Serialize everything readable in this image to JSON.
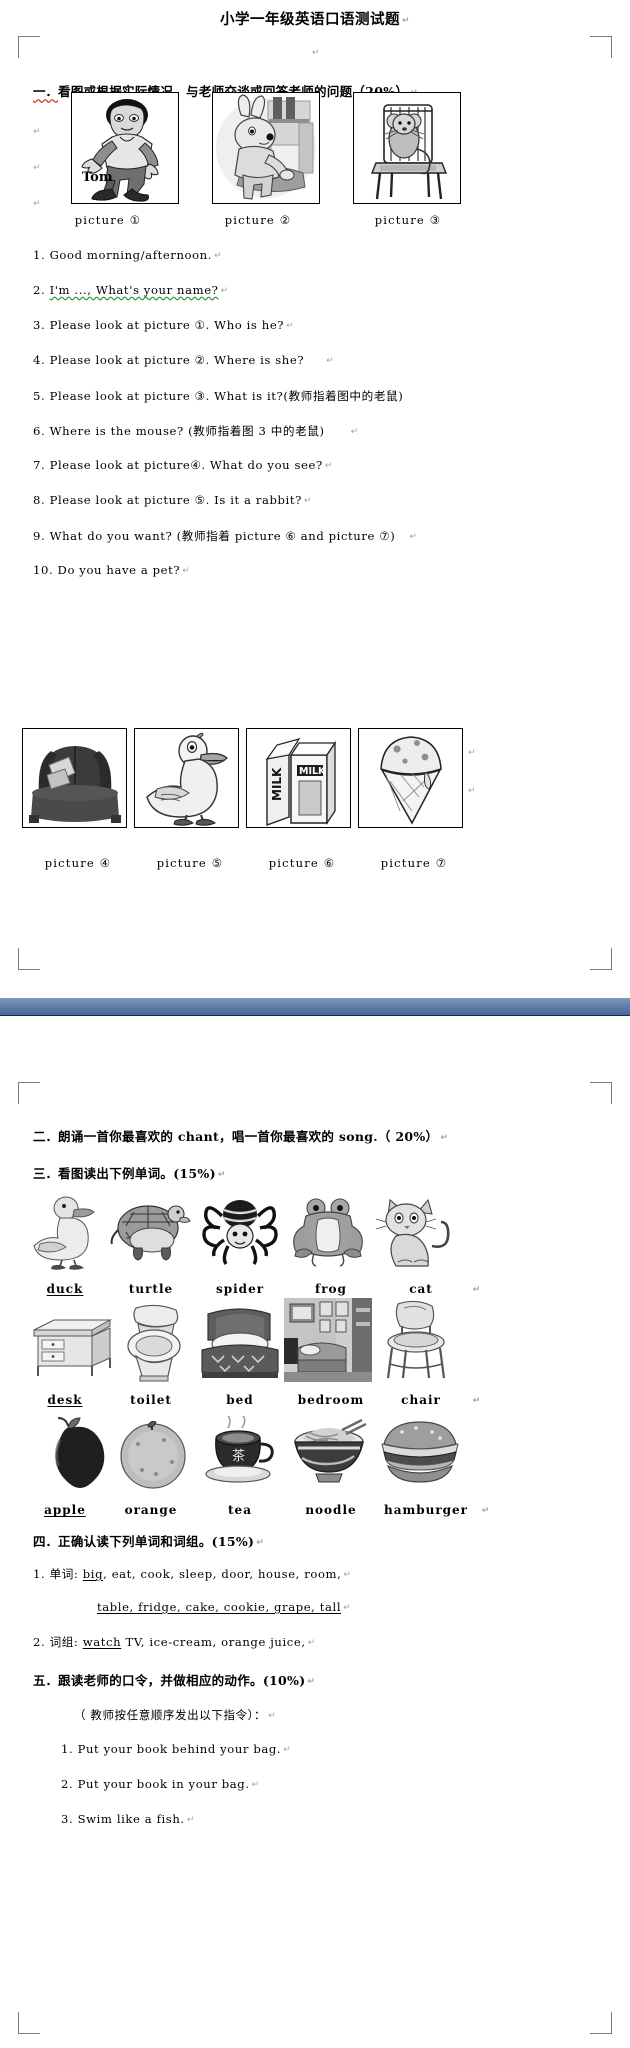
{
  "document": {
    "title": "小学一年级英语口语测试题",
    "pilcrow": "↵"
  },
  "section1": {
    "heading_num": "一．",
    "heading_text": "看图或根据实际情况，与老师交谈或回答老师的问题（20%）",
    "pictures_top": [
      {
        "caption": "picture",
        "num": "①",
        "icon": "boy-walking-icon",
        "label": "Tom"
      },
      {
        "caption": "picture",
        "num": "②",
        "icon": "rabbit-at-desk-icon",
        "label": ""
      },
      {
        "caption": "picture",
        "num": "③",
        "icon": "mouse-on-chair-icon",
        "label": ""
      }
    ],
    "questions": [
      {
        "n": "1.",
        "text": "Good morning/afternoon."
      },
      {
        "n": "2.",
        "text": "I'm ..., What's your name?"
      },
      {
        "n": "3.",
        "text": "Please look at picture ①. Who is he?"
      },
      {
        "n": "4.",
        "text": "Please look at picture ②. Where is she?"
      },
      {
        "n": "5.",
        "text": "Please look at picture ③.  What is it?(教师指着图中的老鼠)"
      },
      {
        "n": "6.",
        "text": "Where is the mouse? (教师指着图 3 中的老鼠)"
      },
      {
        "n": "7.",
        "text": "Please look at picture④.  What do you see?"
      },
      {
        "n": "8.",
        "text": "Please look at picture ⑤. Is it a rabbit?"
      },
      {
        "n": "9.",
        "text": "What do you want? (教师指着 picture ⑥  and picture ⑦)"
      },
      {
        "n": "10.",
        "text": "Do you have a pet?"
      }
    ],
    "pictures_bottom": [
      {
        "caption": "picture",
        "num": "④",
        "icon": "armchair-icon"
      },
      {
        "caption": "picture",
        "num": "⑤",
        "icon": "duck-icon"
      },
      {
        "caption": "picture",
        "num": "⑥",
        "icon": "milk-carton-icon"
      },
      {
        "caption": "picture",
        "num": "⑦",
        "icon": "ice-cream-cone-icon"
      }
    ]
  },
  "section2": {
    "heading_num": "二．",
    "heading_text": "朗诵一首你最喜欢的 chant，唱一首你最喜欢的 song.（ 20%）"
  },
  "section3": {
    "heading_num": "三．",
    "heading_text": "看图读出下例单词。(15%)",
    "rows": [
      [
        {
          "word": "duck",
          "icon": "duck-icon",
          "misspelled": true
        },
        {
          "word": "turtle",
          "icon": "turtle-icon",
          "misspelled": false
        },
        {
          "word": "spider",
          "icon": "spider-icon",
          "misspelled": false
        },
        {
          "word": "frog",
          "icon": "frog-icon",
          "misspelled": false
        },
        {
          "word": "cat",
          "icon": "cat-icon",
          "misspelled": false
        }
      ],
      [
        {
          "word": "desk",
          "icon": "desk-icon",
          "misspelled": true
        },
        {
          "word": "toilet",
          "icon": "toilet-icon",
          "misspelled": false
        },
        {
          "word": "bed",
          "icon": "bed-icon",
          "misspelled": false
        },
        {
          "word": "bedroom",
          "icon": "bedroom-icon",
          "misspelled": false
        },
        {
          "word": "chair",
          "icon": "stool-chair-icon",
          "misspelled": false
        }
      ],
      [
        {
          "word": "apple",
          "icon": "apple-icon",
          "misspelled": true
        },
        {
          "word": "orange",
          "icon": "orange-icon",
          "misspelled": false
        },
        {
          "word": "tea",
          "icon": "teacup-icon",
          "misspelled": false
        },
        {
          "word": "noodle",
          "icon": "noodle-bowl-icon",
          "misspelled": false
        },
        {
          "word": "hamburger",
          "icon": "hamburger-icon",
          "misspelled": false
        }
      ]
    ]
  },
  "section4": {
    "heading_num": "四．",
    "heading_text": "正确认读下列单词和词组。(15%)",
    "items": [
      {
        "n": "1.",
        "label": "单词:",
        "line1_first": "big",
        "line1_rest": ", eat, cook, sleep, door, house, room,",
        "line2": "table, fridge, cake, cookie, grape,  tall"
      },
      {
        "n": "2.",
        "label": "词组:",
        "first": "watch",
        "rest": " TV, ice-cream, orange juice,"
      }
    ]
  },
  "section5": {
    "heading_num": "五．",
    "heading_text": "跟读老师的口令，并做相应的动作。(10%)",
    "note": "（ 教师按任意顺序发出以下指令）：",
    "commands": [
      {
        "n": "1.",
        "text": "Put your book behind your bag."
      },
      {
        "n": "2.",
        "text": "Put your book in your bag."
      },
      {
        "n": "3.",
        "text": "Swim like a fish."
      }
    ]
  },
  "colors": {
    "separator_band": "#5c79a8",
    "spell_error_underline": "#d43c2a",
    "grammar_error_underline": "#2f8f3a",
    "pilcrow": "#9aa4b5"
  }
}
